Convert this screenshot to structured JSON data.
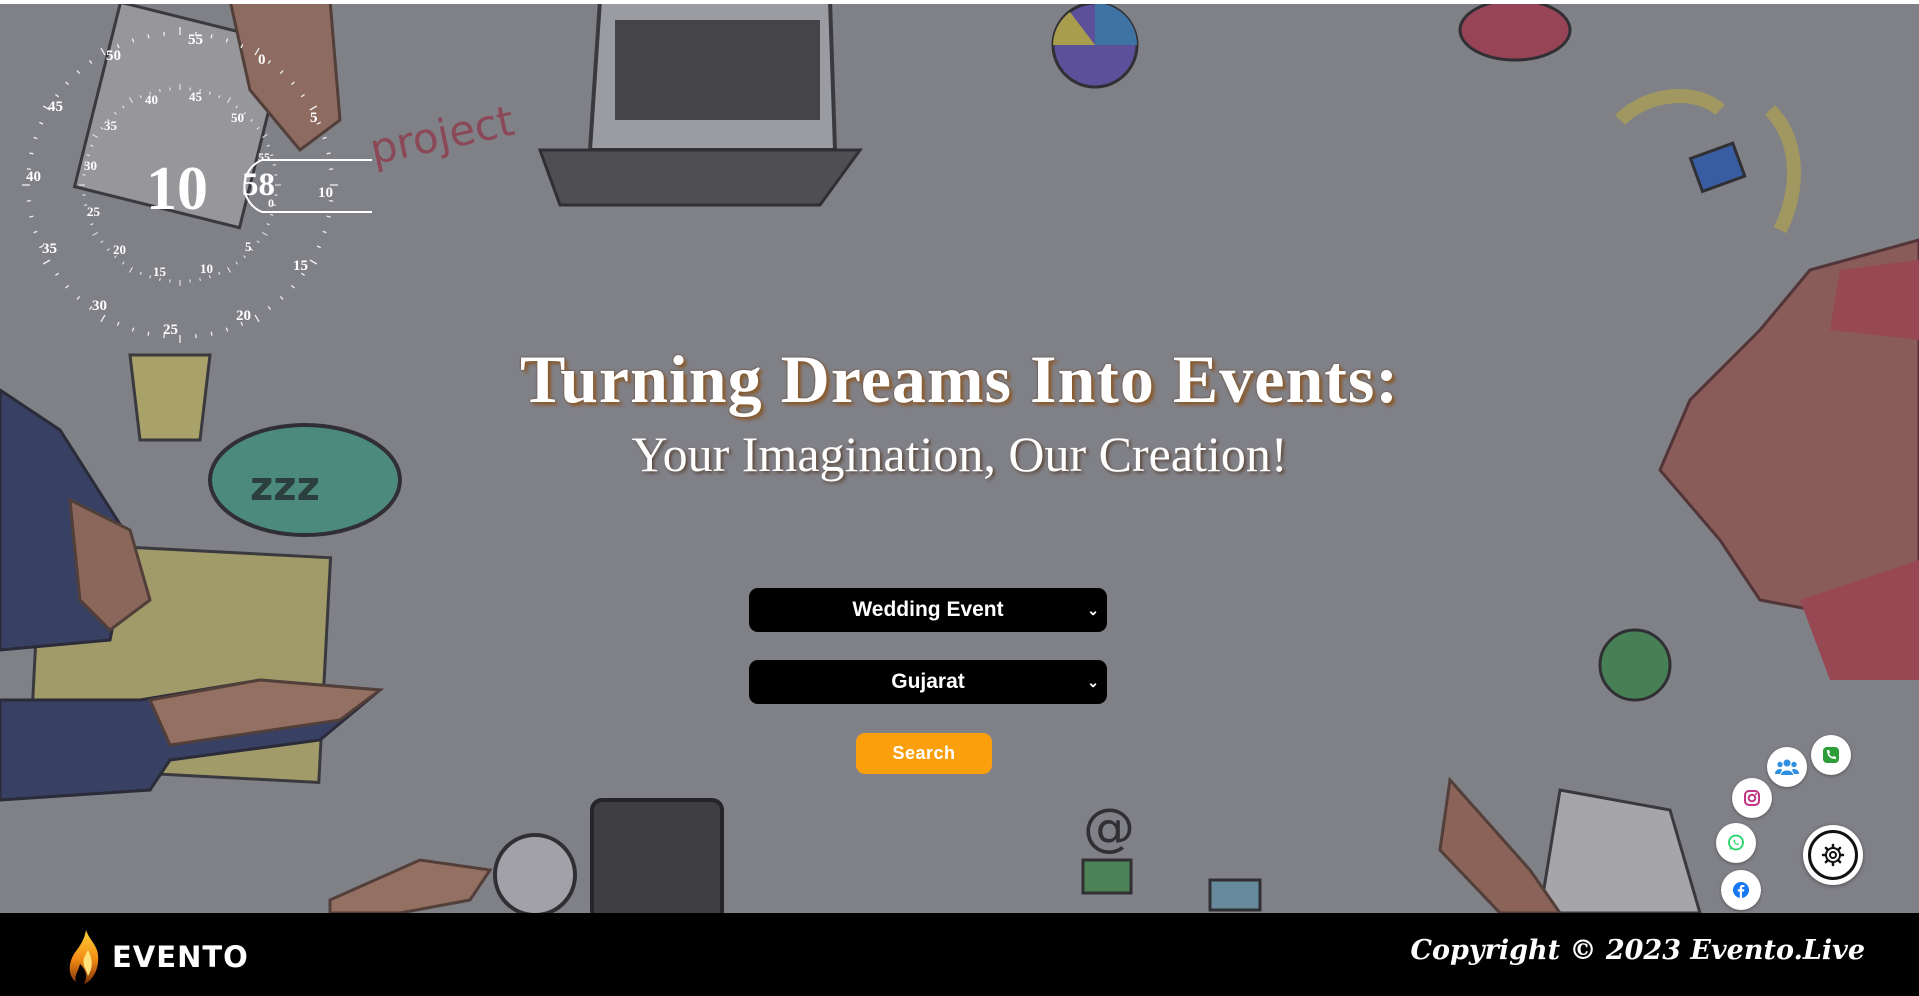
{
  "clock": {
    "hour": "10",
    "minute": "58",
    "outer_labels": [
      "55",
      "0",
      "5",
      "10",
      "15",
      "20",
      "25",
      "30",
      "35",
      "40",
      "45",
      "50"
    ],
    "inner_labels": [
      "45",
      "50",
      "5",
      "10",
      "15",
      "20",
      "25",
      "30",
      "35",
      "40"
    ],
    "second_labels": [
      "55",
      "0"
    ]
  },
  "hero": {
    "title": "Turning Dreams Into Events:",
    "subtitle": "Your Imagination, Our Creation!"
  },
  "search": {
    "event_select": {
      "selected": "Wedding Event"
    },
    "state_select": {
      "selected": "Gujarat"
    },
    "button_label": "Search"
  },
  "social": {
    "icons": [
      "phone-icon",
      "group-icon",
      "instagram-icon",
      "whatsapp-icon",
      "facebook-icon",
      "settings-icon"
    ],
    "colors": {
      "phone": "#2e9e3a",
      "group": "#2f8fe0",
      "instagram": "#c13584",
      "whatsapp": "#25d366",
      "facebook": "#1877f2"
    }
  },
  "footer": {
    "brand": "EVENTO",
    "copyright": "Copyright © 2023 Evento.Live"
  },
  "colors": {
    "accent": "#fb9f0c",
    "footer_bg": "#000000",
    "select_bg": "#000000"
  }
}
